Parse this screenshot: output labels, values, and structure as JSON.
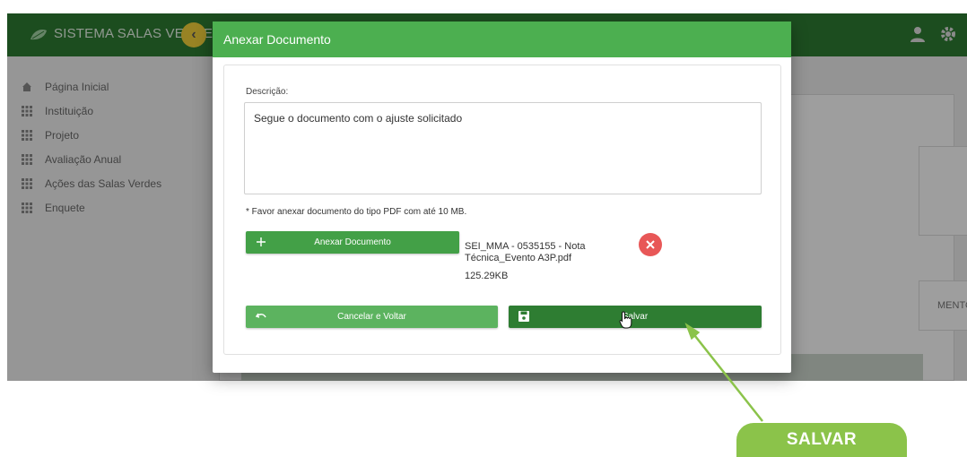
{
  "app": {
    "brand": "SISTEMA SALAS VERDES",
    "sidebar": {
      "items": [
        {
          "label": "Página Inicial",
          "icon": "home-icon"
        },
        {
          "label": "Instituição",
          "icon": "grid-icon"
        },
        {
          "label": "Projeto",
          "icon": "grid-icon"
        },
        {
          "label": "Avaliação Anual",
          "icon": "grid-icon"
        },
        {
          "label": "Ações das Salas Verdes",
          "icon": "grid-icon"
        },
        {
          "label": "Enquete",
          "icon": "grid-icon"
        }
      ]
    },
    "table_header_partial": "MENTO"
  },
  "modal": {
    "title": "Anexar Documento",
    "description_label": "Descrição:",
    "description_value": "Segue o documento com o ajuste solicitado",
    "hint": "* Favor anexar documento do tipo PDF com até 10 MB.",
    "attach_button": "Anexar Documento",
    "file": {
      "name": "SEI_MMA - 0535155 - Nota Técnica_Evento A3P.pdf",
      "size": "125.29KB"
    },
    "cancel_button": "Cancelar e Voltar",
    "save_button": "Salvar"
  },
  "callout": {
    "label": "SALVAR"
  },
  "colors": {
    "header_green": "#4caf50",
    "topbar_green": "#2e7d32",
    "save_green": "#2e7d32",
    "attach_green": "#43a047",
    "remove_red": "#e85757",
    "callout_green": "#8bc34a",
    "collapse_yellow": "#f5d33a"
  }
}
